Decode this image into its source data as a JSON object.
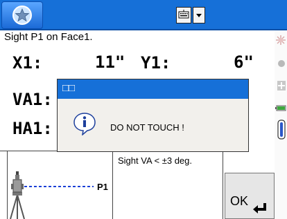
{
  "taskbar": {
    "start_icon": "start-icon",
    "keyboard_icon": "keyboard-icon",
    "dropdown_icon": "chevron-down-icon"
  },
  "main": {
    "instruction": "Sight P1 on Face1.",
    "x_label": "X1:",
    "x_value": "11\"",
    "y_label": "Y1:",
    "y_value": "6\"",
    "va_label": "VA1:",
    "ha_label": "HA1:"
  },
  "dialog": {
    "title": "□□",
    "message": "DO NOT TOUCH !",
    "icon": "info-icon"
  },
  "diagram": {
    "target_label": "P1"
  },
  "bottom": {
    "message": "Sight VA < ±3 deg.",
    "ok_label": "OK"
  },
  "colors": {
    "taskbar_blue": "#1670d8",
    "dialog_blue": "#1670d8",
    "line_blue": "#1a3fd6"
  }
}
